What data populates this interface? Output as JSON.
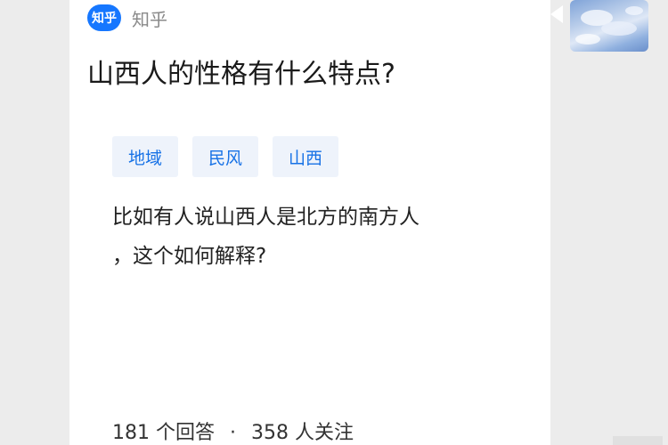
{
  "source": {
    "logo_text": "知乎",
    "name": "知乎"
  },
  "question": {
    "title": "山西人的性格有什么特点?",
    "tags": [
      "地域",
      "民风",
      "山西"
    ],
    "detail_line1": "比如有人说山西人是北方的南方人",
    "detail_line2": "，这个如何解释?"
  },
  "stats": {
    "answers": "181 个回答",
    "separator": "·",
    "followers": "358 人关注"
  },
  "colors": {
    "brand": "#1677ff",
    "tag_text": "#1772e6",
    "tag_bg": "#eef3fb"
  },
  "icons": {
    "logo": "zhihu-logo-icon",
    "thumbnail": "sky-thumbnail-image"
  }
}
